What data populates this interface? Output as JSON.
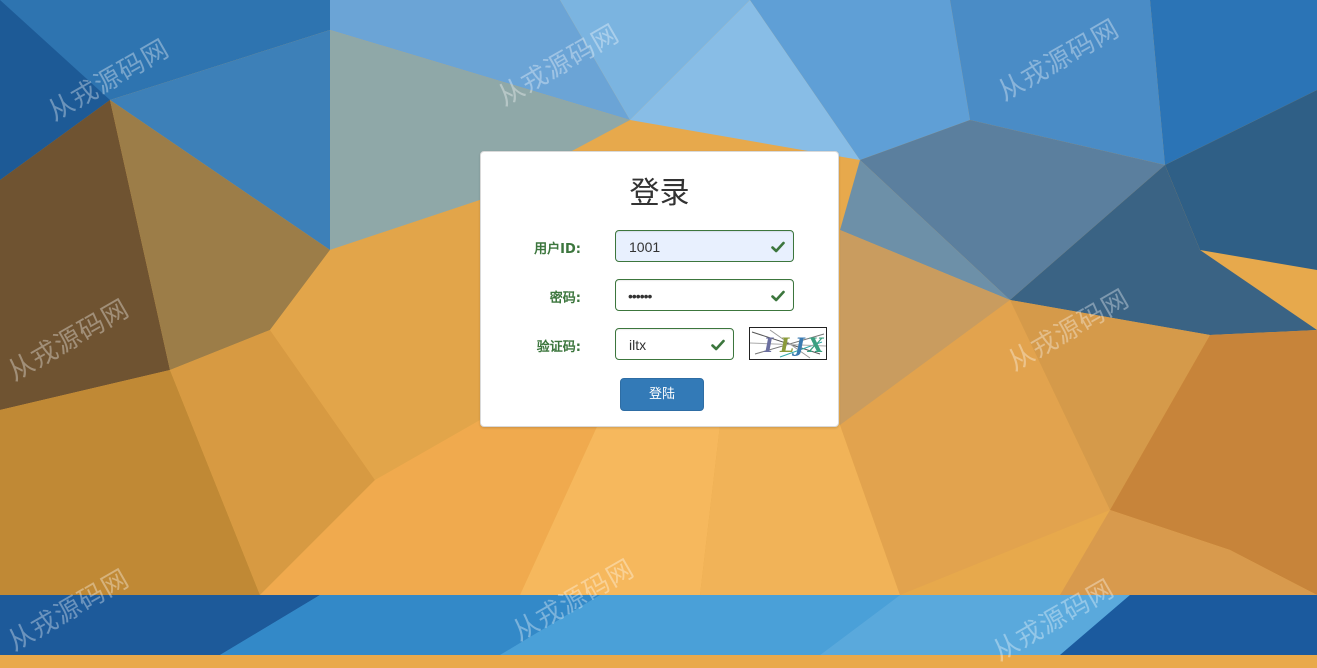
{
  "login": {
    "title": "登录",
    "user_id_label": "用户ID:",
    "user_id_value": "1001",
    "password_label": "密码:",
    "password_value": "••••••",
    "captcha_label": "验证码:",
    "captcha_value": "iltx",
    "captcha_image_text": "ILJX",
    "submit_label": "登陆"
  },
  "watermark": {
    "text": "从戎源码网"
  },
  "colors": {
    "valid_green": "#3c763d",
    "primary_button": "#337ab7",
    "autofill_bg": "#e8f0fe"
  },
  "icons": {
    "validation": "check-icon"
  }
}
